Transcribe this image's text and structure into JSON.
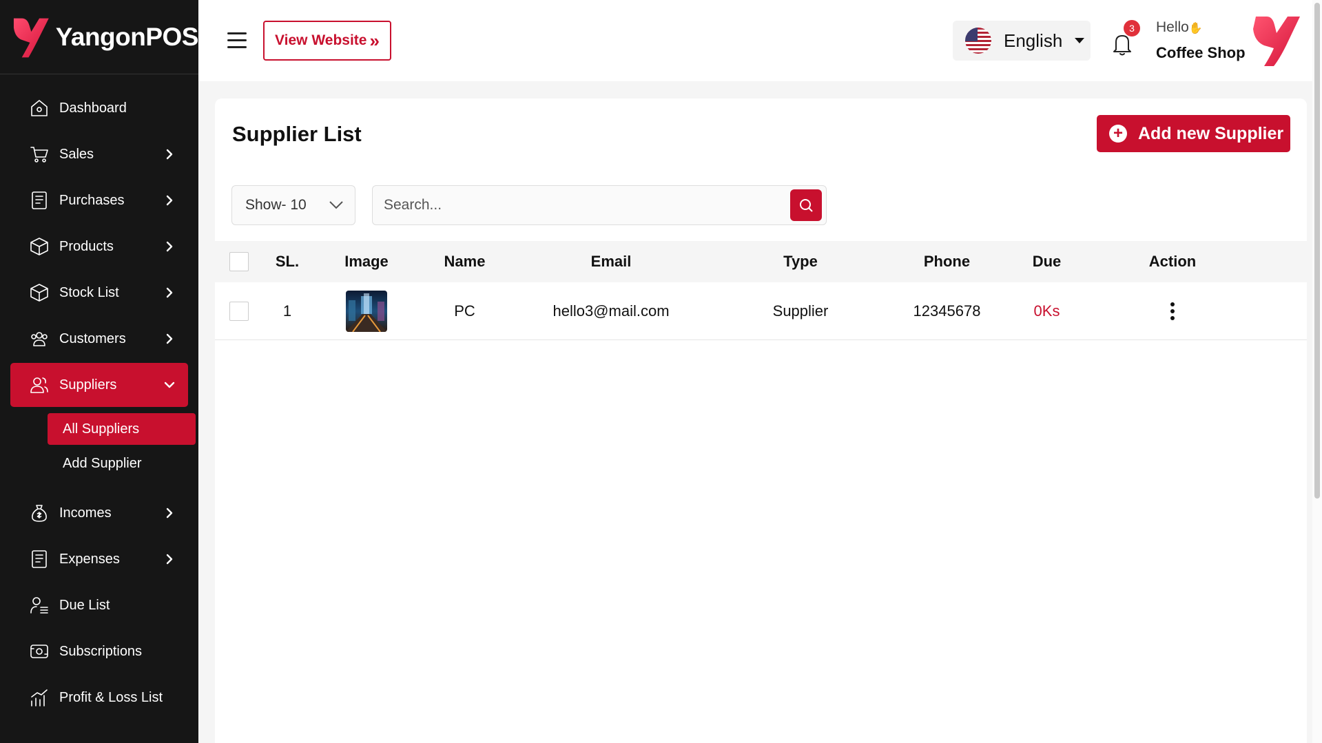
{
  "brand": {
    "name": "YangonPOS"
  },
  "header": {
    "view_website": "View Website",
    "language": "English",
    "notification_count": "3",
    "greeting": "Hello",
    "user_name": "Coffee Shop"
  },
  "sidebar": {
    "items": [
      {
        "label": "Dashboard",
        "icon": "home-icon"
      },
      {
        "label": "Sales",
        "icon": "cart-icon"
      },
      {
        "label": "Purchases",
        "icon": "receipt-icon"
      },
      {
        "label": "Products",
        "icon": "box-icon"
      },
      {
        "label": "Stock List",
        "icon": "box-icon"
      },
      {
        "label": "Customers",
        "icon": "users-icon"
      },
      {
        "label": "Suppliers",
        "icon": "user-group-icon"
      },
      {
        "label": "Incomes",
        "icon": "money-bag-icon"
      },
      {
        "label": "Expenses",
        "icon": "receipt-icon"
      },
      {
        "label": "Due List",
        "icon": "user-list-icon"
      },
      {
        "label": "Subscriptions",
        "icon": "subscription-icon"
      },
      {
        "label": "Profit & Loss List",
        "icon": "chart-icon"
      }
    ],
    "sub_items": [
      {
        "label": "All Suppliers"
      },
      {
        "label": "Add Supplier"
      }
    ]
  },
  "page": {
    "title": "Supplier List",
    "add_button": "Add new Supplier",
    "show_select": "Show- 10",
    "search_placeholder": "Search..."
  },
  "table": {
    "columns": [
      "SL.",
      "Image",
      "Name",
      "Email",
      "Type",
      "Phone",
      "Due",
      "Action"
    ],
    "rows": [
      {
        "sl": "1",
        "name": "PC",
        "email": "hello3@mail.com",
        "type": "Supplier",
        "phone": "12345678",
        "due": "0Ks"
      }
    ]
  },
  "colors": {
    "accent": "#c8102e",
    "sidebar_bg": "#161616"
  }
}
